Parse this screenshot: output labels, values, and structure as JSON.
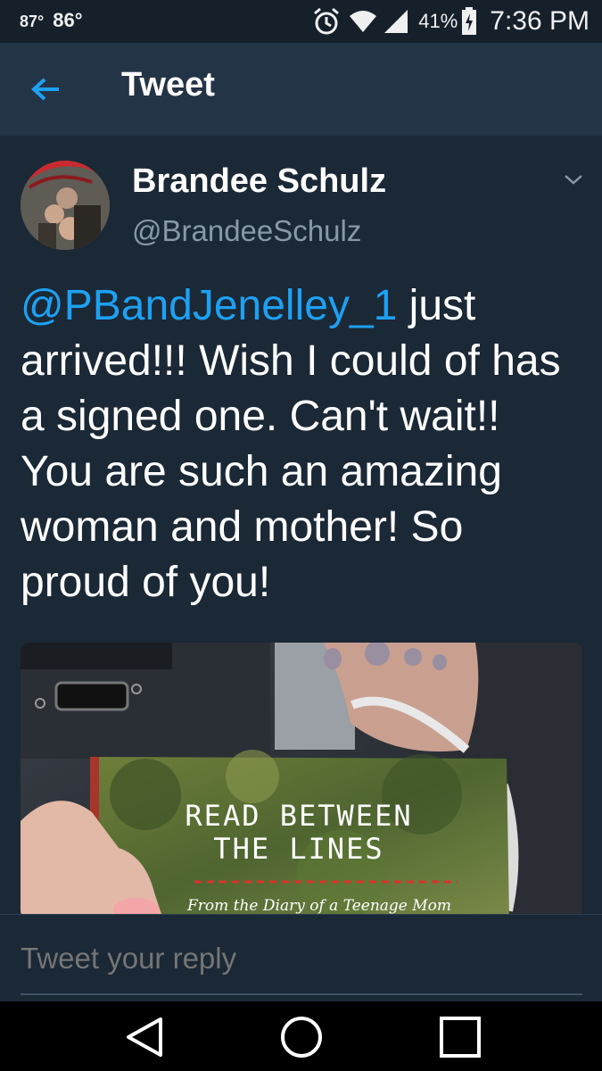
{
  "status_bar": {
    "temp_1": "87°",
    "temp_2": "86°",
    "battery": "41%",
    "time": "7:36 PM"
  },
  "header": {
    "title": "Tweet"
  },
  "tweet": {
    "author_name": "Brandee Schulz",
    "author_handle": "@BrandeeSchulz",
    "mention": "@PBandJenelley_1",
    "text": " just arrived!!! Wish I could of has a signed one. Can't wait!! You are such an amazing woman and mother! So proud of you!",
    "media": {
      "book_title_line1": "READ BETWEEN",
      "book_title_line2": "THE LINES",
      "book_subtitle": "From the Diary of a Teenage Mom"
    }
  },
  "reply": {
    "placeholder": "Tweet your reply"
  },
  "colors": {
    "accent": "#1da1f2",
    "background": "#1b2836",
    "header": "#243447",
    "secondary_text": "#8899a6"
  },
  "icons": {
    "back": "arrow-left-icon",
    "chevron": "chevron-down-icon",
    "alarm": "alarm-clock-icon",
    "wifi": "wifi-icon",
    "signal": "cell-signal-icon",
    "battery": "battery-charging-icon",
    "nav_back": "triangle-back-icon",
    "nav_home": "circle-home-icon",
    "nav_recents": "square-recents-icon"
  }
}
